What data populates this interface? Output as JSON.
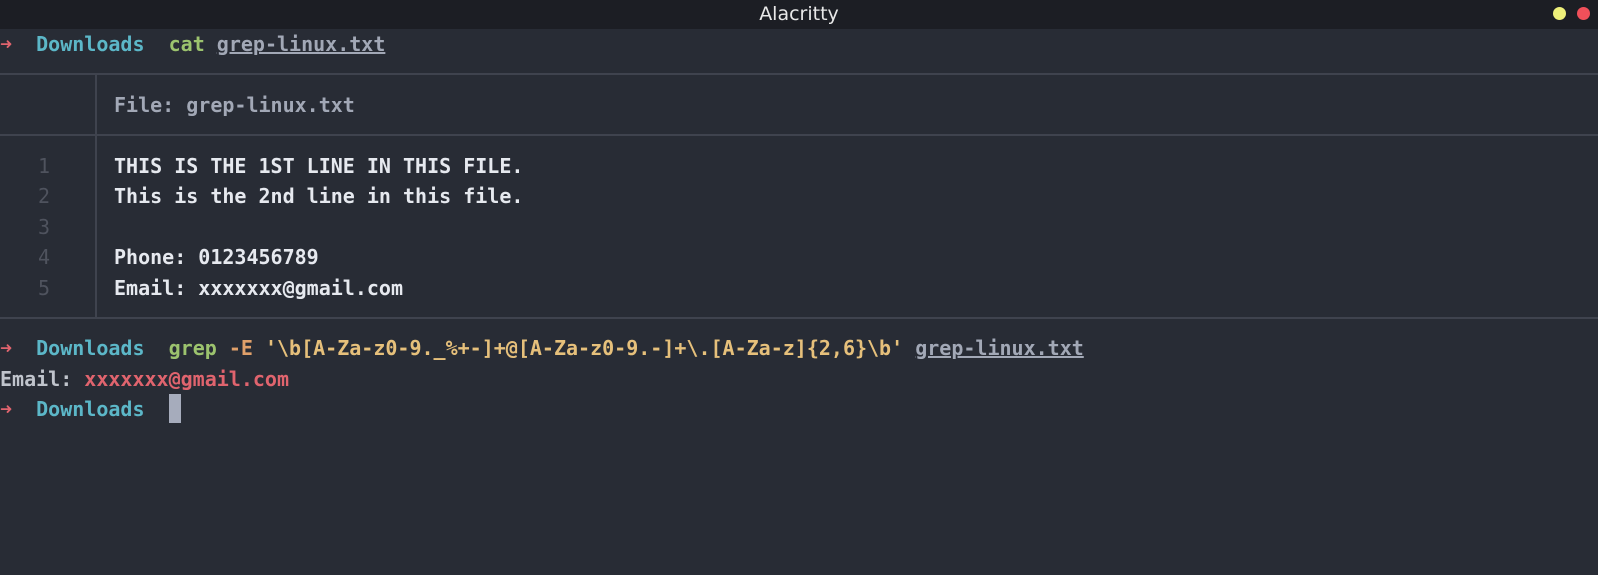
{
  "window": {
    "title": "Alacritty"
  },
  "prompt": {
    "arrow": "➜",
    "directory": "Downloads"
  },
  "command1": {
    "program": "cat",
    "file": "grep-linux.txt"
  },
  "bat": {
    "header": "File: grep-linux.txt",
    "lines": [
      {
        "number": "1",
        "text": "THIS IS THE 1ST LINE IN THIS FILE."
      },
      {
        "number": "2",
        "text": "This is the 2nd line in this file."
      },
      {
        "number": "3",
        "text": ""
      },
      {
        "number": "4",
        "text": "Phone: 0123456789"
      },
      {
        "number": "5",
        "text": "Email: xxxxxxx@gmail.com"
      }
    ]
  },
  "command2": {
    "program": "grep",
    "flag": "-E",
    "pattern": "'\\b[A-Za-z0-9._%+-]+@[A-Za-z0-9.-]+\\.[A-Za-z]{2,6}\\b'",
    "file": "grep-linux.txt"
  },
  "output": {
    "label": "Email: ",
    "match": "xxxxxxx@gmail.com"
  },
  "colors": {
    "background": "#282c35",
    "titlebar": "#1c1e24",
    "arrow": "#e0646e",
    "directory": "#5cb7c8",
    "command": "#9cc36e",
    "string": "#e6c07b",
    "match": "#e0646e"
  }
}
